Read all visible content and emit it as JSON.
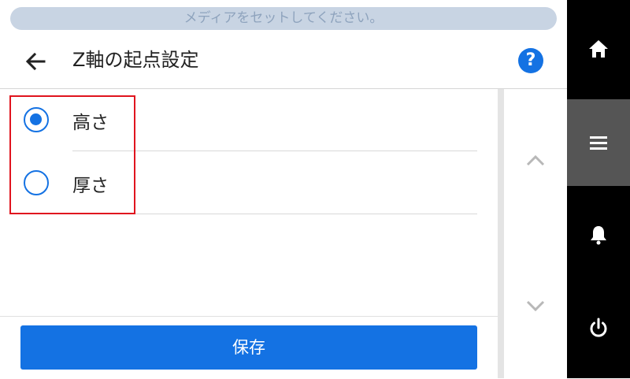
{
  "status": {
    "message": "メディアをセットしてください。"
  },
  "header": {
    "title": "Z軸の起点設定",
    "help_label": "?"
  },
  "options": [
    {
      "label": "高さ",
      "selected": true
    },
    {
      "label": "厚さ",
      "selected": false
    }
  ],
  "footer": {
    "save_label": "保存"
  },
  "sidebar": {
    "items": [
      {
        "icon": "home-icon"
      },
      {
        "icon": "menu-icon",
        "active": true
      },
      {
        "icon": "bell-icon"
      },
      {
        "icon": "power-icon"
      }
    ]
  },
  "colors": {
    "accent": "#1472e3",
    "highlight": "#e0141e",
    "sidebar": "#000000",
    "sidebar_active": "#555555"
  }
}
